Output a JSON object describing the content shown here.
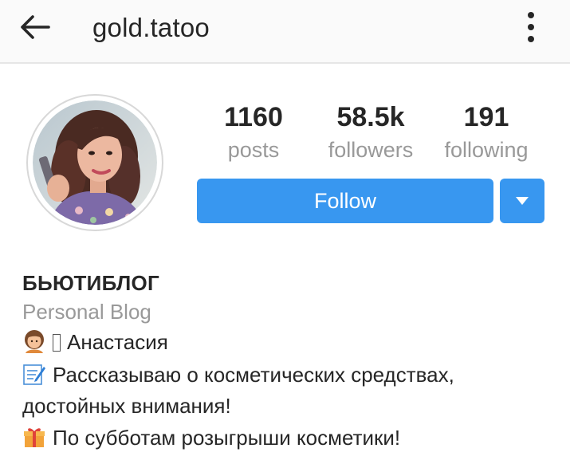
{
  "header": {
    "username": "gold.tatoo",
    "back_icon": "arrow-left-icon",
    "more_icon": "more-vertical-icon"
  },
  "stats": {
    "posts": {
      "value": "1160",
      "label": "posts"
    },
    "followers": {
      "value": "58.5k",
      "label": "followers"
    },
    "following": {
      "value": "191",
      "label": "following"
    }
  },
  "actions": {
    "follow_label": "Follow",
    "dropdown_icon": "caret-down-icon",
    "accent_color": "#3897f0"
  },
  "bio": {
    "name": "БЬЮТИБЛОГ",
    "category": "Personal Blog",
    "lines": [
      {
        "emoji": "woman-emoji",
        "text": "Анастасия"
      },
      {
        "emoji": "memo-emoji",
        "text": "Рассказываю о косметических средствах,"
      },
      {
        "emoji": "",
        "text": "достойных внимания!"
      },
      {
        "emoji": "gift-emoji",
        "text": "По субботам розыгрыши косметики!"
      }
    ]
  }
}
